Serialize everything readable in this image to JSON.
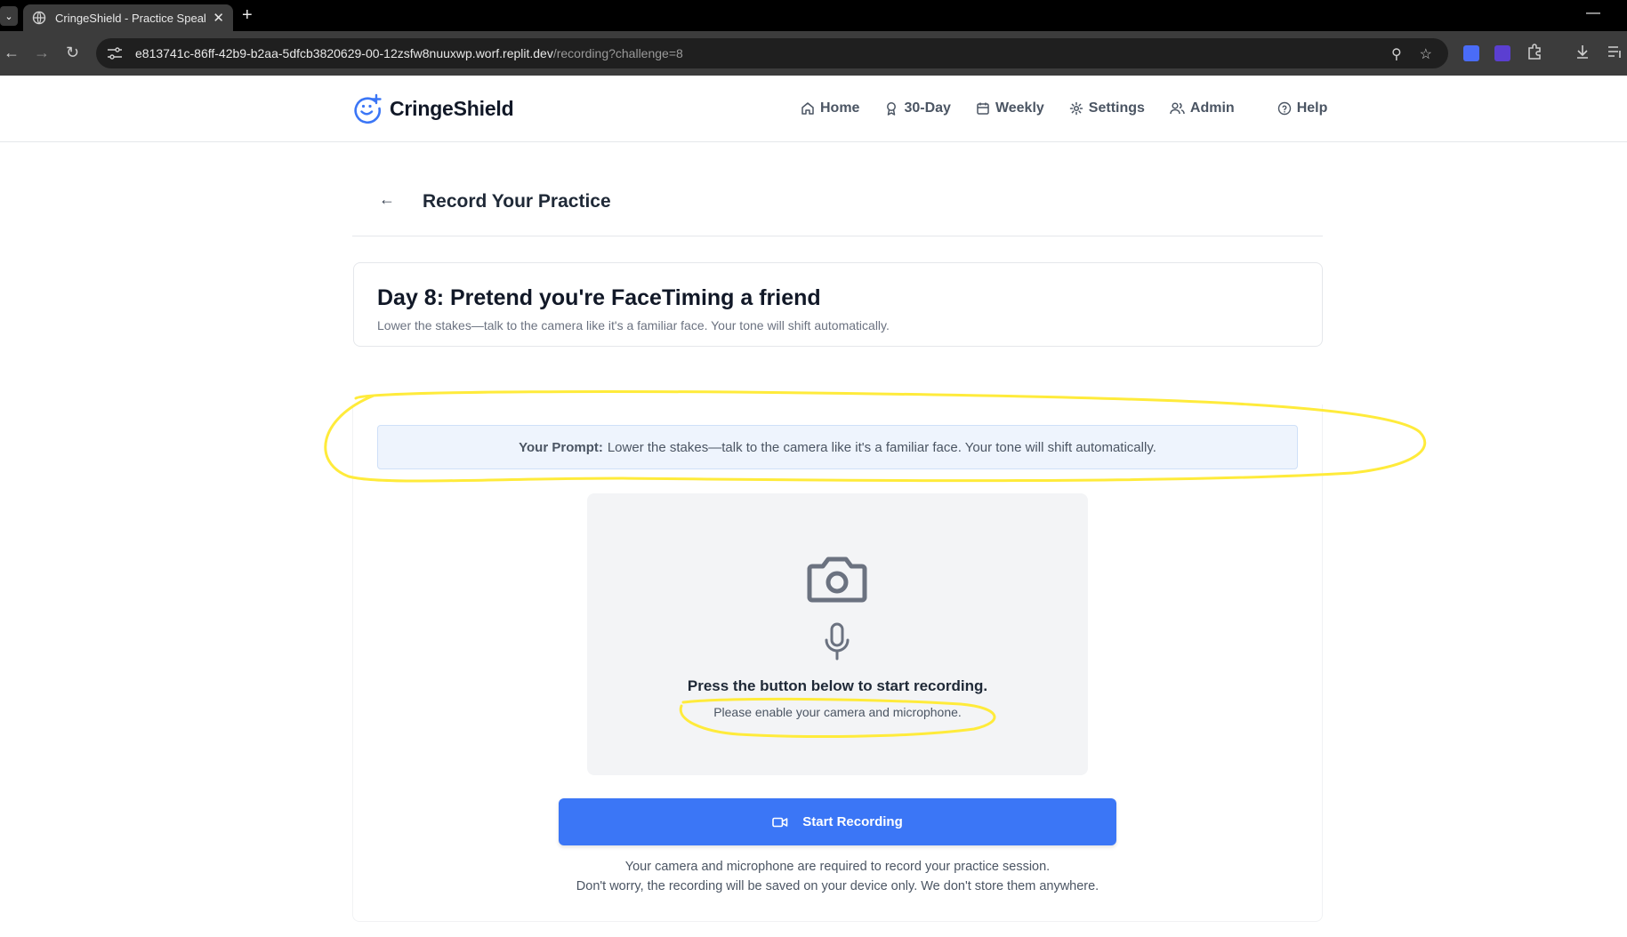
{
  "browser": {
    "tab_title": "CringeShield - Practice Speakin",
    "tab_close": "✕",
    "new_tab": "+",
    "minimize": "—",
    "url_host": "e813741c-86ff-42b9-b2aa-5dfcb3820629-00-12zsfw8nuuxwp.worf.replit.dev",
    "url_path": "/recording?challenge=8",
    "back": "←",
    "forward": "→",
    "reload": "↻",
    "zoom_icon": "⚲",
    "star_icon": "☆"
  },
  "header": {
    "logo_text": "CringeShield",
    "nav": [
      {
        "label": "Home",
        "icon": "home-icon"
      },
      {
        "label": "30-Day",
        "icon": "award-icon"
      },
      {
        "label": "Weekly",
        "icon": "calendar-icon"
      },
      {
        "label": "Settings",
        "icon": "gear-icon"
      },
      {
        "label": "Admin",
        "icon": "users-icon"
      },
      {
        "label": "Help",
        "icon": "help-circle-icon"
      }
    ]
  },
  "page": {
    "back_label": "←",
    "title": "Record Your Practice"
  },
  "challenge": {
    "title": "Day 8: Pretend you're FaceTiming a friend",
    "description": "Lower the stakes—talk to the camera like it's a familiar face. Your tone will shift automatically."
  },
  "prompt": {
    "label": "Your Prompt:",
    "text": "Lower the stakes—talk to the camera like it's a familiar face. Your tone will shift automatically."
  },
  "preview": {
    "main_text": "Press the button below to start recording.",
    "sub_text": "Please enable your camera and microphone."
  },
  "record_button": {
    "label": "Start Recording"
  },
  "notes": {
    "line1": "Your camera and microphone are required to record your practice session.",
    "line2": "Don't worry, the recording will be saved on your device only. We don't store them anywhere."
  },
  "colors": {
    "accent": "#3b76f6",
    "annotation": "#ffeb3b"
  }
}
